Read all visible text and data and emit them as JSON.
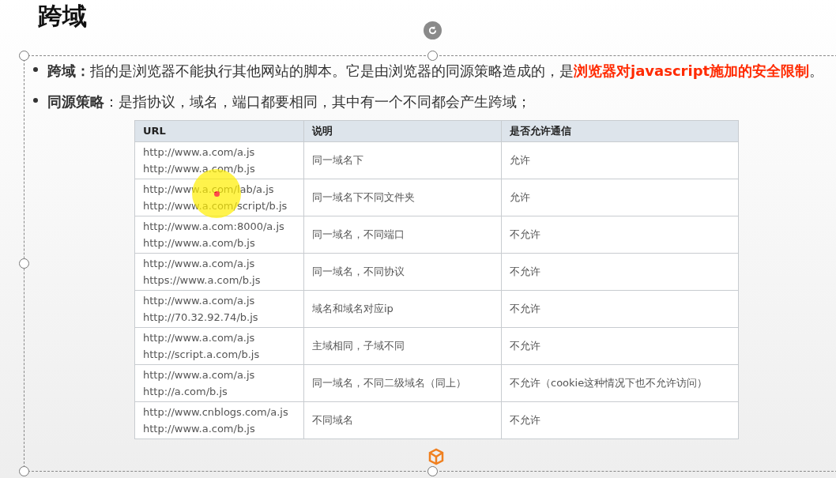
{
  "slide": {
    "title": "跨域",
    "bullets": [
      {
        "term": "跨域：",
        "text": "指的是浏览器不能执行其他网站的脚本。它是由浏览器的同源策略造成的，是",
        "highlight": "浏览器对javascript施加的安全限制",
        "tail": "。"
      },
      {
        "term": "同源策略",
        "text": "：是指协议，域名，端口都要相同，其中有一个不同都会产生跨域；"
      }
    ],
    "table": {
      "columns": [
        "URL",
        "说明",
        "是否允许通信"
      ],
      "rows": [
        {
          "urls": [
            "http://www.a.com/a.js",
            "http://www.a.com/b.js"
          ],
          "note": "同一域名下",
          "allowed": "允许"
        },
        {
          "urls": [
            "http://www.a.com/lab/a.js",
            "http://www.a.com/script/b.js"
          ],
          "note": "同一域名下不同文件夹",
          "allowed": "允许"
        },
        {
          "urls": [
            "http://www.a.com:8000/a.js",
            "http://www.a.com/b.js"
          ],
          "note": "同一域名，不同端口",
          "allowed": "不允许"
        },
        {
          "urls": [
            "http://www.a.com/a.js",
            "https://www.a.com/b.js"
          ],
          "note": "同一域名，不同协议",
          "allowed": "不允许"
        },
        {
          "urls": [
            "http://www.a.com/a.js",
            "http://70.32.92.74/b.js"
          ],
          "note": "域名和域名对应ip",
          "allowed": "不允许"
        },
        {
          "urls": [
            "http://www.a.com/a.js",
            "http://script.a.com/b.js"
          ],
          "note": "主域相同，子域不同",
          "allowed": "不允许"
        },
        {
          "urls": [
            "http://www.a.com/a.js",
            "http://a.com/b.js"
          ],
          "note": "同一域名，不同二级域名（同上）",
          "allowed": "不允许（cookie这种情况下也不允许访问）"
        },
        {
          "urls": [
            "http://www.cnblogs.com/a.js",
            "http://www.a.com/b.js"
          ],
          "note": "不同域名",
          "allowed": "不允许"
        }
      ]
    }
  }
}
